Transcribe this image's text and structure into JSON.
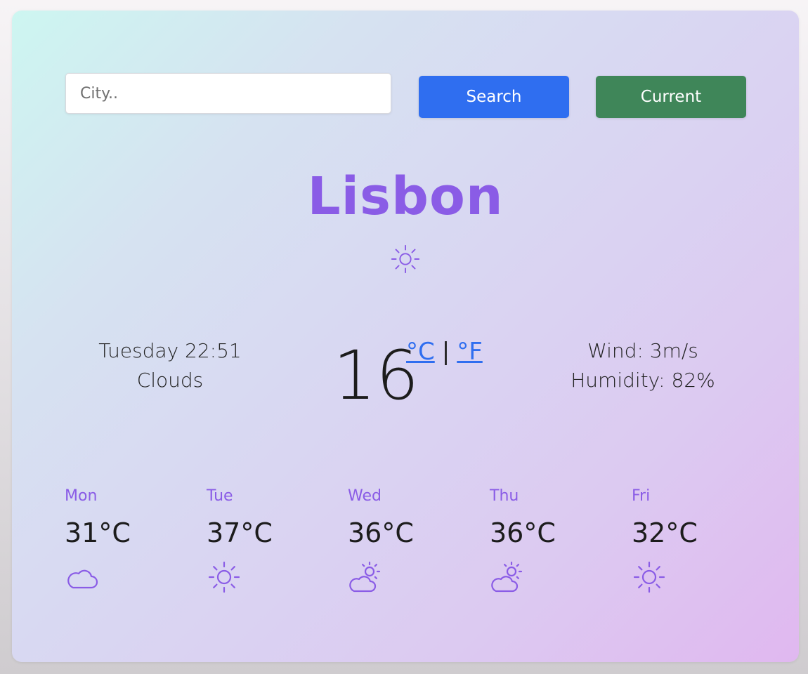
{
  "search": {
    "placeholder": "City..",
    "search_label": "Search",
    "current_label": "Current"
  },
  "weather": {
    "city": "Lisbon",
    "icon": "sun-icon",
    "datetime": "Tuesday 22:51",
    "description": "Clouds",
    "temperature": "16",
    "unit_c": "°C",
    "unit_sep": "|",
    "unit_f": "°F",
    "wind": "Wind: 3m/s",
    "humidity": "Humidity: 82%"
  },
  "forecast": [
    {
      "day": "Mon",
      "temp": "31°C",
      "icon": "cloud-icon"
    },
    {
      "day": "Tue",
      "temp": "37°C",
      "icon": "sun-icon"
    },
    {
      "day": "Wed",
      "temp": "36°C",
      "icon": "partly-cloudy-icon"
    },
    {
      "day": "Thu",
      "temp": "36°C",
      "icon": "partly-cloudy-icon"
    },
    {
      "day": "Fri",
      "temp": "32°C",
      "icon": "sun-icon"
    }
  ],
  "colors": {
    "accent": "#8a5ce6",
    "search_button": "#2f6ef0",
    "current_button": "#3f8659",
    "unit_link": "#2f6ef0"
  }
}
